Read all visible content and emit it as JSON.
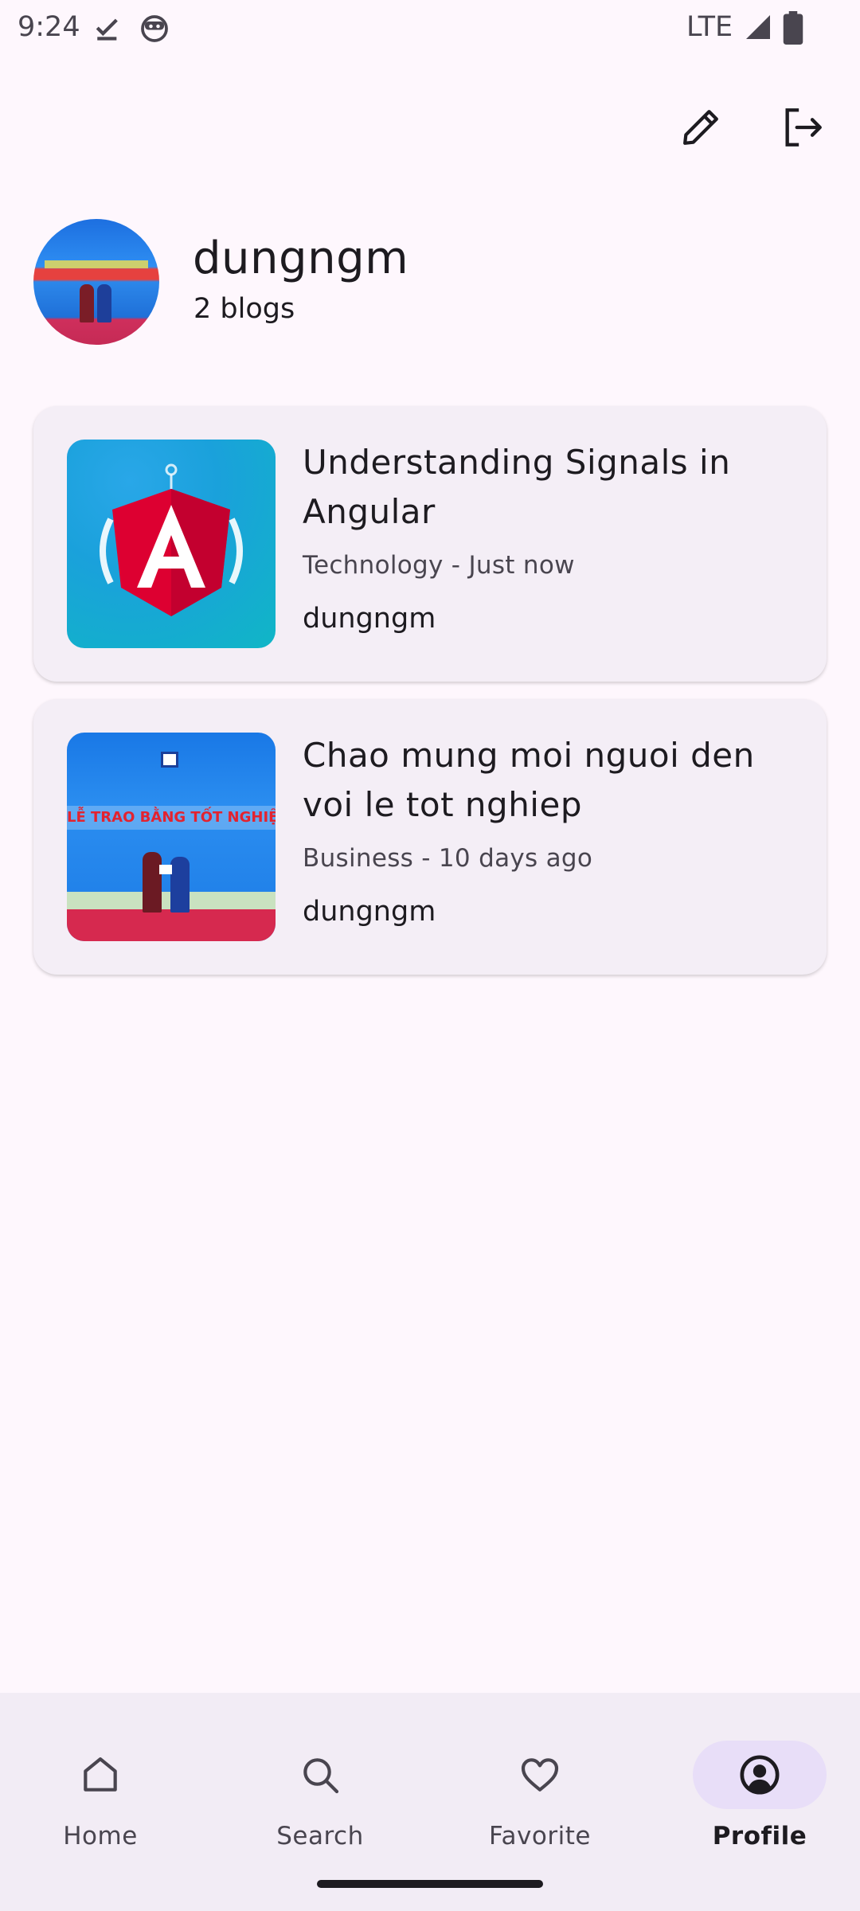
{
  "status_bar": {
    "time": "9:24",
    "network": "LTE",
    "icons": [
      "check-download-icon",
      "android-face-icon",
      "signal-icon",
      "battery-icon"
    ]
  },
  "top_actions": [
    "edit-pencil-icon",
    "logout-icon"
  ],
  "profile": {
    "username": "dungngm",
    "blog_count": "2 blogs"
  },
  "blogs": [
    {
      "title": "Understanding Signals in Angular",
      "meta": "Technology - Just now",
      "author": "dungngm",
      "thumbnail": "angular-logo-image"
    },
    {
      "title": "Chao mung moi nguoi den voi le tot nghiep",
      "meta": "Business - 10 days ago",
      "author": "dungngm",
      "thumbnail": "graduation-ceremony-image",
      "thumbnail_text": "LỄ TRAO BẰNG TỐT NGHIỆP"
    }
  ],
  "nav": {
    "items": [
      {
        "label": "Home",
        "icon": "home-icon"
      },
      {
        "label": "Search",
        "icon": "search-icon"
      },
      {
        "label": "Favorite",
        "icon": "heart-icon"
      },
      {
        "label": "Profile",
        "icon": "profile-icon"
      }
    ],
    "active": "Profile"
  },
  "colors": {
    "background": "#fef7fd",
    "card": "#f4eef6",
    "nav_background": "#f2ecf5",
    "active_pill": "#e8def8",
    "text": "#1d1b20",
    "secondary_text": "#49454f"
  }
}
